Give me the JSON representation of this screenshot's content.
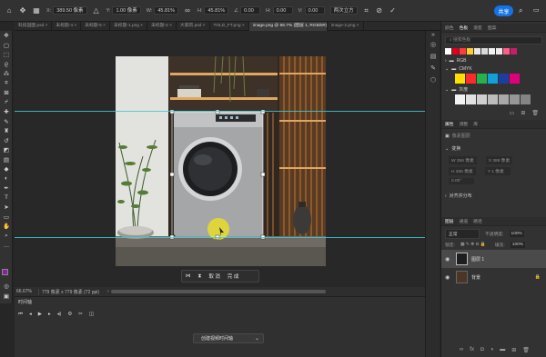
{
  "options_bar": {
    "x_label": "X:",
    "x_value": "389.50 像素",
    "y_label": "Y:",
    "y_value": "1.00 像素",
    "w_label": "W:",
    "w_value": "45.81%",
    "h_label": "H:",
    "h_value": "45.81%",
    "angle_value": "0.00",
    "hskew_label": "H:",
    "hskew_value": "0.00",
    "vskew_label": "V:",
    "vskew_value": "0.00",
    "interp_value": "两次立方",
    "share_label": "共享"
  },
  "doc_tabs": [
    {
      "label": "科技园图.psd ×"
    },
    {
      "label": "未标题-4 ×"
    },
    {
      "label": "未标题-5 ×"
    },
    {
      "label": "未标题-1.png ×"
    },
    {
      "label": "未标题-2 ×"
    },
    {
      "label": "大家的.psd ×"
    },
    {
      "label": "TOLD_FT.png ×"
    },
    {
      "label": "image.png @ 66.7% (图层 1, RGB/8#) * ×",
      "active": true
    },
    {
      "label": "image-2.png ×"
    }
  ],
  "transform_bar": {
    "cancel_label": "取 消",
    "confirm_label": "完 成"
  },
  "status": {
    "zoom": "66.67%",
    "doc_info": "779 像素 x 779 像素 (72 ppi)"
  },
  "timeline": {
    "title": "时间轴",
    "create_label": "创建视频时间轴"
  },
  "swatches_panel": {
    "tabs": [
      "颜色",
      "色板",
      "渐变",
      "图案"
    ],
    "active_tab": 1,
    "search_placeholder": "搜索色板",
    "groups": [
      {
        "name": "RGB"
      },
      {
        "name": "CMYK",
        "colors": [
          "#ffde00",
          "#ff2a2a",
          "#26b14b",
          "#13a0d8",
          "#1d3e9e",
          "#e2007a"
        ]
      },
      {
        "name": "灰度",
        "colors": [
          "#f3f3f3",
          "#e1e1e1",
          "#cfcfcf",
          "#bcbcbc",
          "#a9a9a9",
          "#969696",
          "#848484"
        ]
      }
    ],
    "recent_colors": [
      "#ffffff",
      "#e1001a",
      "#ff3b3b",
      "#ffcf2e",
      "#e9e9e9",
      "#dadada",
      "#f3f3f3",
      "#ececec",
      "#ff5c8a",
      "#c81e6a"
    ]
  },
  "properties_panel": {
    "tabs": [
      "属性",
      "调整",
      "库"
    ],
    "layer_type": "像素图层",
    "transform_title": "变换",
    "w_value": "W 356 像素",
    "x_value": "X 389 像素",
    "h_value": "H 356 像素",
    "y_value": "Y 1 像素",
    "angle_value": "0.00°",
    "align_title": "对齐并分布"
  },
  "layers_panel": {
    "tabs": [
      "图层",
      "通道",
      "路径"
    ],
    "blend_mode": "正常",
    "opacity_label": "不透明度:",
    "opacity_value": "100%",
    "lock_label": "锁定:",
    "fill_label": "填充:",
    "fill_value": "100%",
    "layers": [
      {
        "name": "图层 1",
        "selected": true
      },
      {
        "name": "背景",
        "locked": true
      }
    ]
  },
  "colors": {
    "accent": "#1473e6",
    "guide": "#3fc9d6",
    "foreground": "#8b1fa8",
    "background": "#ffffff"
  }
}
